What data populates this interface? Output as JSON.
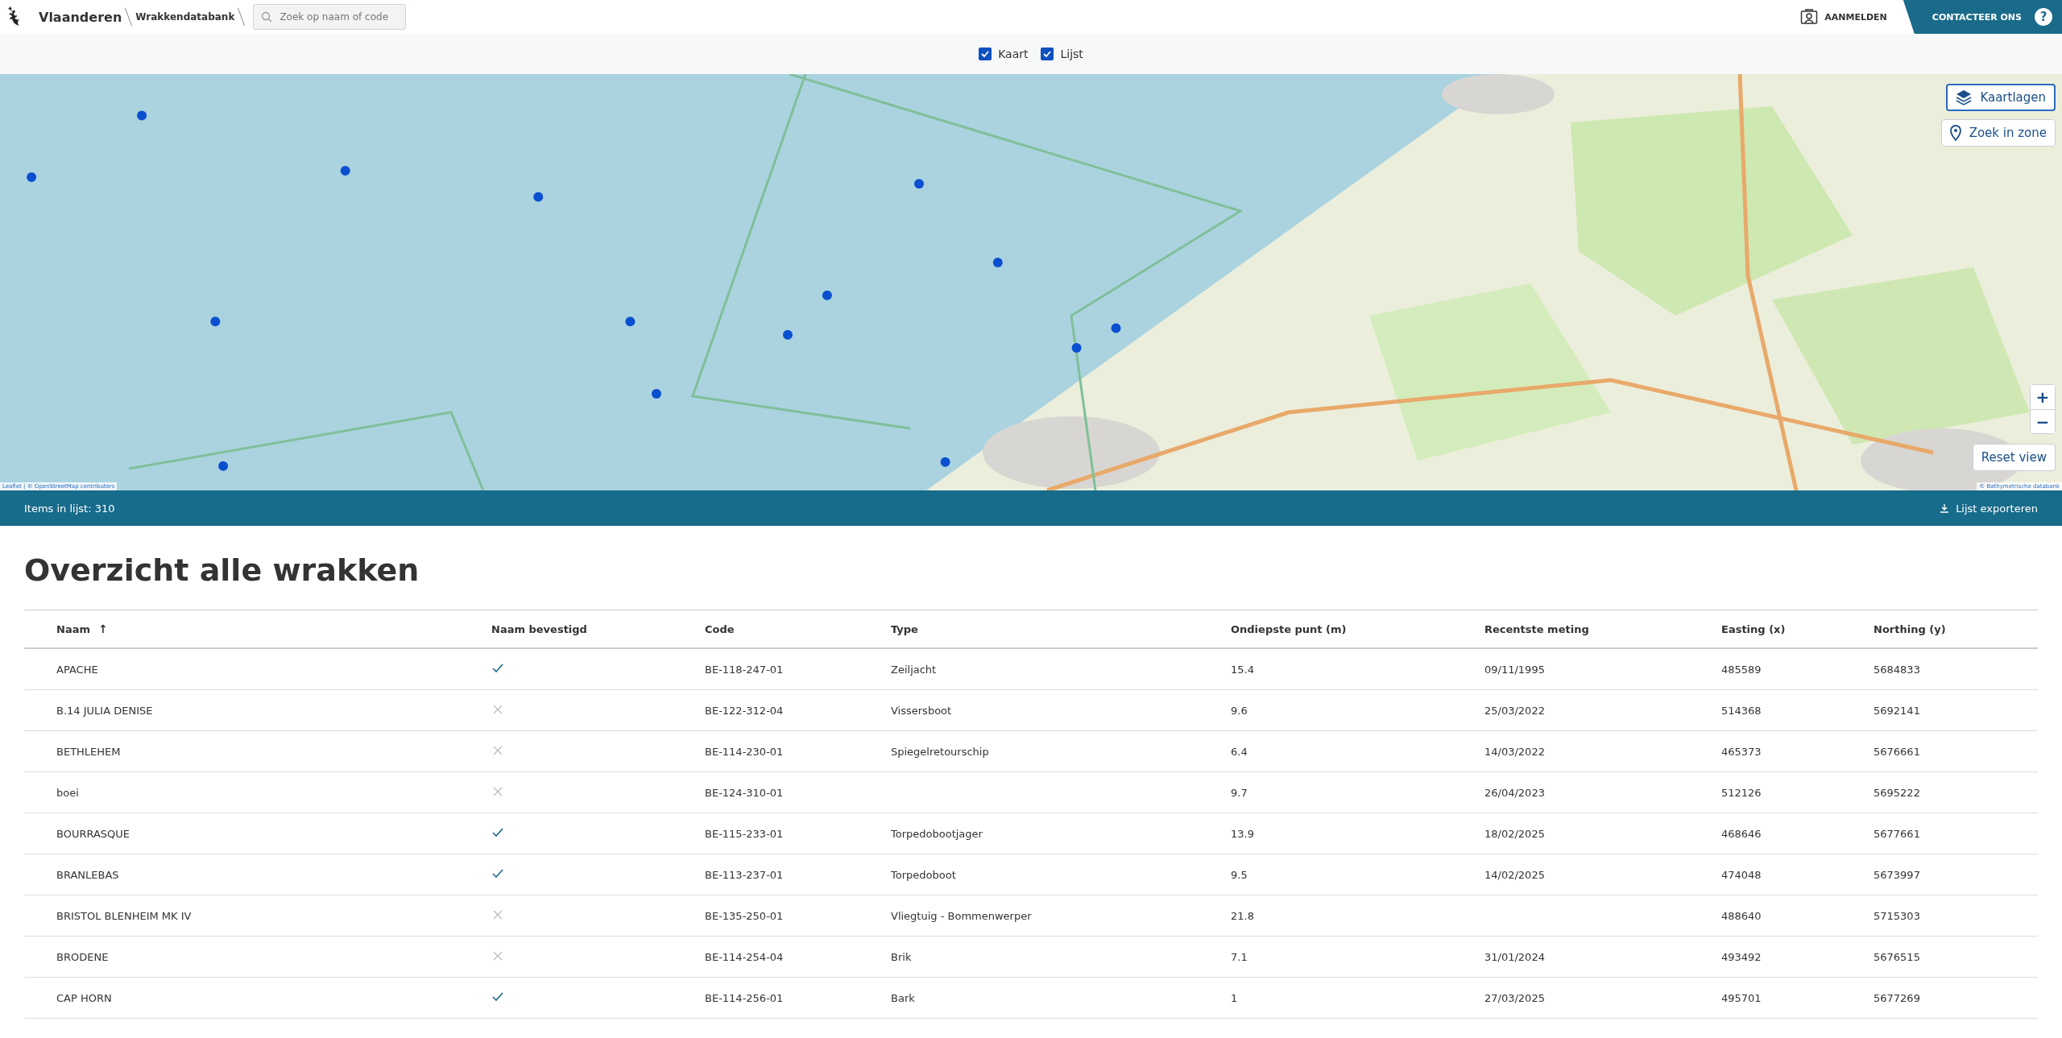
{
  "header": {
    "brand": "Vlaanderen",
    "app_title": "Wrakkendatabank",
    "search": {
      "placeholder": "Zoek op naam of code"
    },
    "login": "AANMELDEN",
    "contact": "CONTACTEER ONS",
    "help": "?"
  },
  "view_toggles": [
    {
      "label": "Kaart",
      "checked": true
    },
    {
      "label": "Lijst",
      "checked": true
    }
  ],
  "map": {
    "kind": "picture",
    "layers_button": "Kaartlagen",
    "zone_button": "Zoek in zone",
    "zoom_in": "+",
    "zoom_out": "−",
    "reset_button": "Reset view",
    "attribution_left": "Leaflet | © OpenStreetMap contributors",
    "attribution_right": "© Bathymetrische databank"
  },
  "list_bar": {
    "count": "Items in lijst: 310",
    "export": "Lijst exporteren"
  },
  "title": "Overzicht alle wrakken",
  "table": {
    "columns": [
      {
        "label": "Naam",
        "sort_indicator": "↑"
      },
      {
        "label": "Naam bevestigd"
      },
      {
        "label": "Code"
      },
      {
        "label": "Type"
      },
      {
        "label": "Ondiepste punt (m)"
      },
      {
        "label": "Recentste meting"
      },
      {
        "label": "Easting (x)"
      },
      {
        "label": "Northing (y)"
      }
    ],
    "rows": [
      {
        "name": "APACHE",
        "confirmed": true,
        "code": "BE-118-247-01",
        "type": "Zeiljacht",
        "depth": "15.4",
        "date": "09/11/1995",
        "easting": "485589",
        "northing": "5684833"
      },
      {
        "name": "B.14 JULIA DENISE",
        "confirmed": false,
        "code": "BE-122-312-04",
        "type": "Vissersboot",
        "depth": "9.6",
        "date": "25/03/2022",
        "easting": "514368",
        "northing": "5692141"
      },
      {
        "name": "BETHLEHEM",
        "confirmed": false,
        "code": "BE-114-230-01",
        "type": "Spiegelretourschip",
        "depth": "6.4",
        "date": "14/03/2022",
        "easting": "465373",
        "northing": "5676661"
      },
      {
        "name": "boei",
        "confirmed": false,
        "code": "BE-124-310-01",
        "depth": "9.7",
        "date": "26/04/2023",
        "easting": "512126",
        "northing": "5695222"
      },
      {
        "name": "BOURRASQUE",
        "confirmed": true,
        "code": "BE-115-233-01",
        "type": "Torpedobootjager",
        "depth": "13.9",
        "date": "18/02/2025",
        "easting": "468646",
        "northing": "5677661"
      },
      {
        "name": "BRANLEBAS",
        "confirmed": true,
        "code": "BE-113-237-01",
        "type": "Torpedoboot",
        "depth": "9.5",
        "date": "14/02/2025",
        "easting": "474048",
        "northing": "5673997"
      },
      {
        "name": "BRISTOL BLENHEIM MK IV",
        "confirmed": false,
        "code": "BE-135-250-01",
        "type": "Vliegtuig - Bommenwerper",
        "depth": "21.8",
        "easting": "488640",
        "northing": "5715303"
      },
      {
        "name": "BRODENE",
        "confirmed": false,
        "code": "BE-114-254-04",
        "type": "Brik",
        "depth": "7.1",
        "date": "31/01/2024",
        "easting": "493492",
        "northing": "5676515"
      },
      {
        "name": "CAP HORN",
        "confirmed": true,
        "code": "BE-114-256-01",
        "type": "Bark",
        "depth": "1",
        "date": "27/03/2025",
        "easting": "495701",
        "northing": "5677269"
      }
    ]
  }
}
